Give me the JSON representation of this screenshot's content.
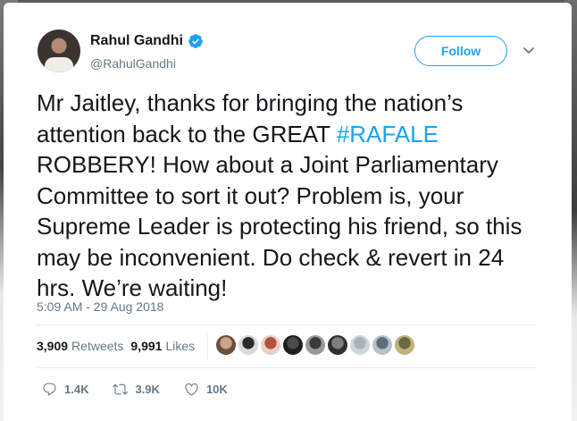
{
  "author": {
    "name": "Rahul Gandhi",
    "handle": "@RahulGandhi",
    "verified": true
  },
  "follow_label": "Follow",
  "tweet": {
    "text_before": "Mr Jaitley, thanks for bringing the nation’s attention back to the GREAT ",
    "hashtag": "#RAFALE",
    "text_after": " ROBBERY! How about a Joint Parliamentary Committee to sort it out? Problem is, your Supreme Leader is protecting his friend, so this may be inconvenient. Do check & revert in 24 hrs. We’re waiting!"
  },
  "timestamp": "5:09 AM - 29 Aug 2018",
  "stats": {
    "retweets_count": "3,909",
    "retweets_label": "Retweets",
    "likes_count": "9,991",
    "likes_label": "Likes"
  },
  "likers": [
    {
      "color": "#c9a48b",
      "ring": "#6b4f3d"
    },
    {
      "color": "#2b2b2b",
      "ring": "#d9d9d9"
    },
    {
      "color": "#b0523e",
      "ring": "#e8cfc5"
    },
    {
      "color": "#4a4a4a",
      "ring": "#1e1e1e"
    },
    {
      "color": "#3b3b3b",
      "ring": "#9a9a9a"
    },
    {
      "color": "#7f7f7f",
      "ring": "#2f2f2f"
    },
    {
      "color": "#a9b3bb",
      "ring": "#cfd6dc"
    },
    {
      "color": "#5b6e7c",
      "ring": "#b9c2c9"
    },
    {
      "color": "#6a6b3e",
      "ring": "#c1b27a"
    }
  ],
  "actions": {
    "replies": "1.4K",
    "retweets": "3.9K",
    "likes": "10K"
  },
  "colors": {
    "accent": "#1da1f2",
    "text": "#14171a",
    "secondary": "#657786"
  },
  "icons": [
    "verified-badge-icon",
    "chevron-down-icon",
    "reply-icon",
    "retweet-icon",
    "like-icon"
  ]
}
